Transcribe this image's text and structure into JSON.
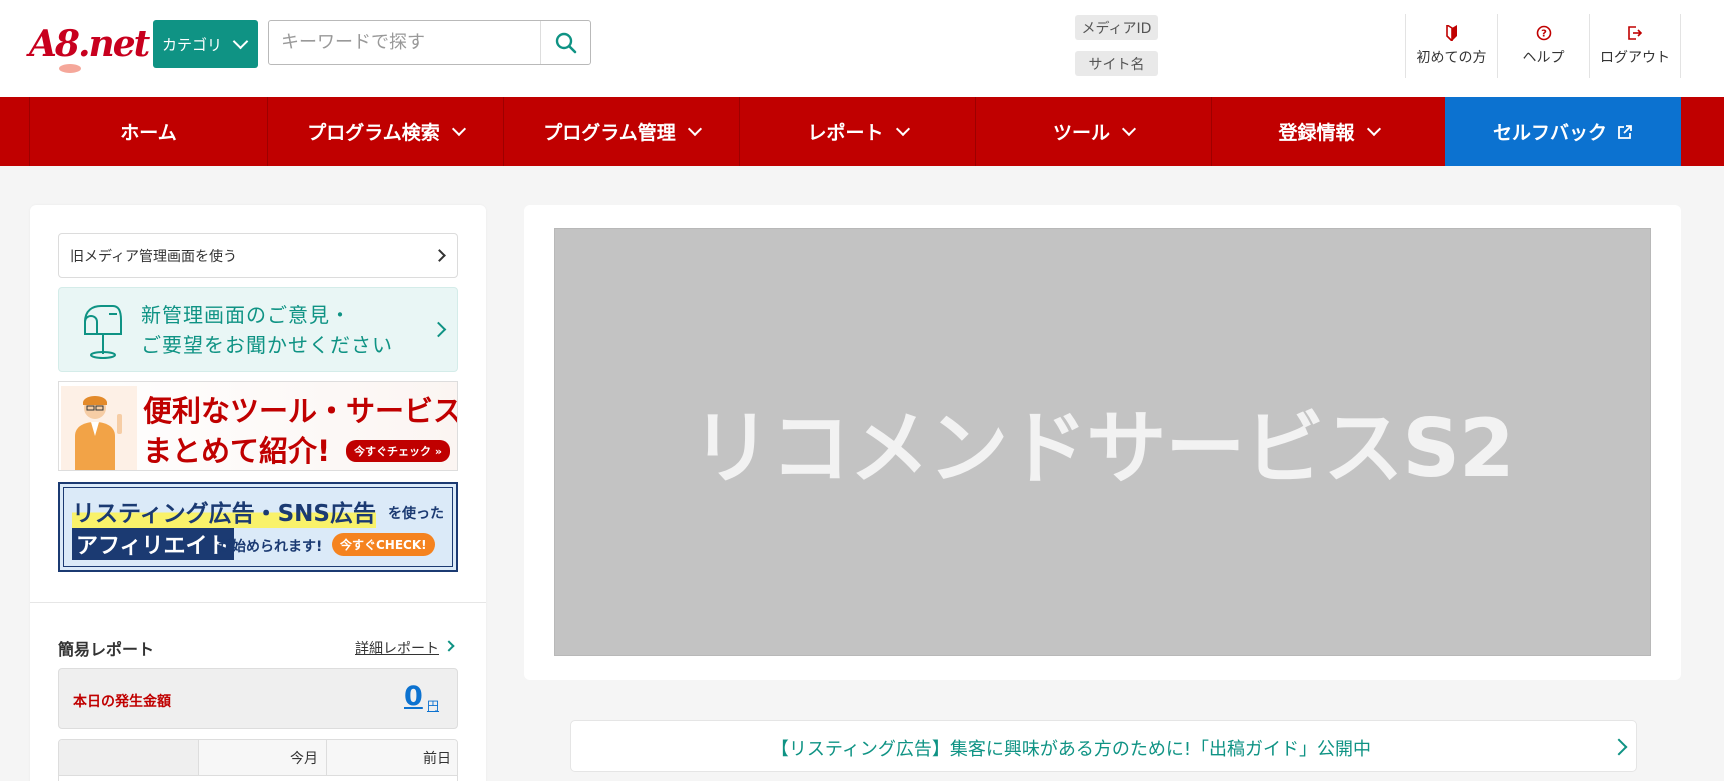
{
  "header": {
    "logo": "A8.net",
    "category_label": "カテゴリ",
    "search_placeholder": "キーワードで探す",
    "media_id_label": "メディアID",
    "site_name_label": "サイト名",
    "util": [
      {
        "label": "初めての方",
        "icon": "beginner-icon"
      },
      {
        "label": "ヘルプ",
        "icon": "help-icon"
      },
      {
        "label": "ログアウト",
        "icon": "logout-icon"
      }
    ]
  },
  "nav": {
    "items": [
      {
        "label": "ホーム",
        "dropdown": false
      },
      {
        "label": "プログラム検索",
        "dropdown": true
      },
      {
        "label": "プログラム管理",
        "dropdown": true
      },
      {
        "label": "レポート",
        "dropdown": true
      },
      {
        "label": "ツール",
        "dropdown": true
      },
      {
        "label": "登録情報",
        "dropdown": true
      }
    ],
    "selfback_label": "セルフバック"
  },
  "sidebar": {
    "old_media_link": "旧メディア管理画面を使う",
    "feedback_line1": "新管理画面のご意見・",
    "feedback_line2": "ご要望をお聞かせください",
    "banner_tools": {
      "line1": "便利なツール・サービス",
      "line2": "まとめて紹介!",
      "cta": "今すぐチェック »"
    },
    "banner_listing": {
      "line1": "リスティング広告・SNS広告",
      "line1_suffix": "を使った",
      "line2": "アフィリエイト",
      "line2_suffix": "が始められます!",
      "cta": "今すぐCHECK!"
    },
    "report": {
      "title": "簡易レポート",
      "detail_link": "詳細レポート",
      "today_label": "本日の発生金額",
      "today_value": "0",
      "today_unit": "円",
      "table_headers": [
        "",
        "今月",
        "前日"
      ]
    }
  },
  "main": {
    "recommend_title": "リコメンドサービスS2",
    "notice_text": "【リスティング広告】集客に興味がある方のために!「出稿ガイド」公開中"
  },
  "colors": {
    "brand_red": "#c00000",
    "teal": "#0f9384",
    "selfback_blue": "#0c72d0"
  }
}
